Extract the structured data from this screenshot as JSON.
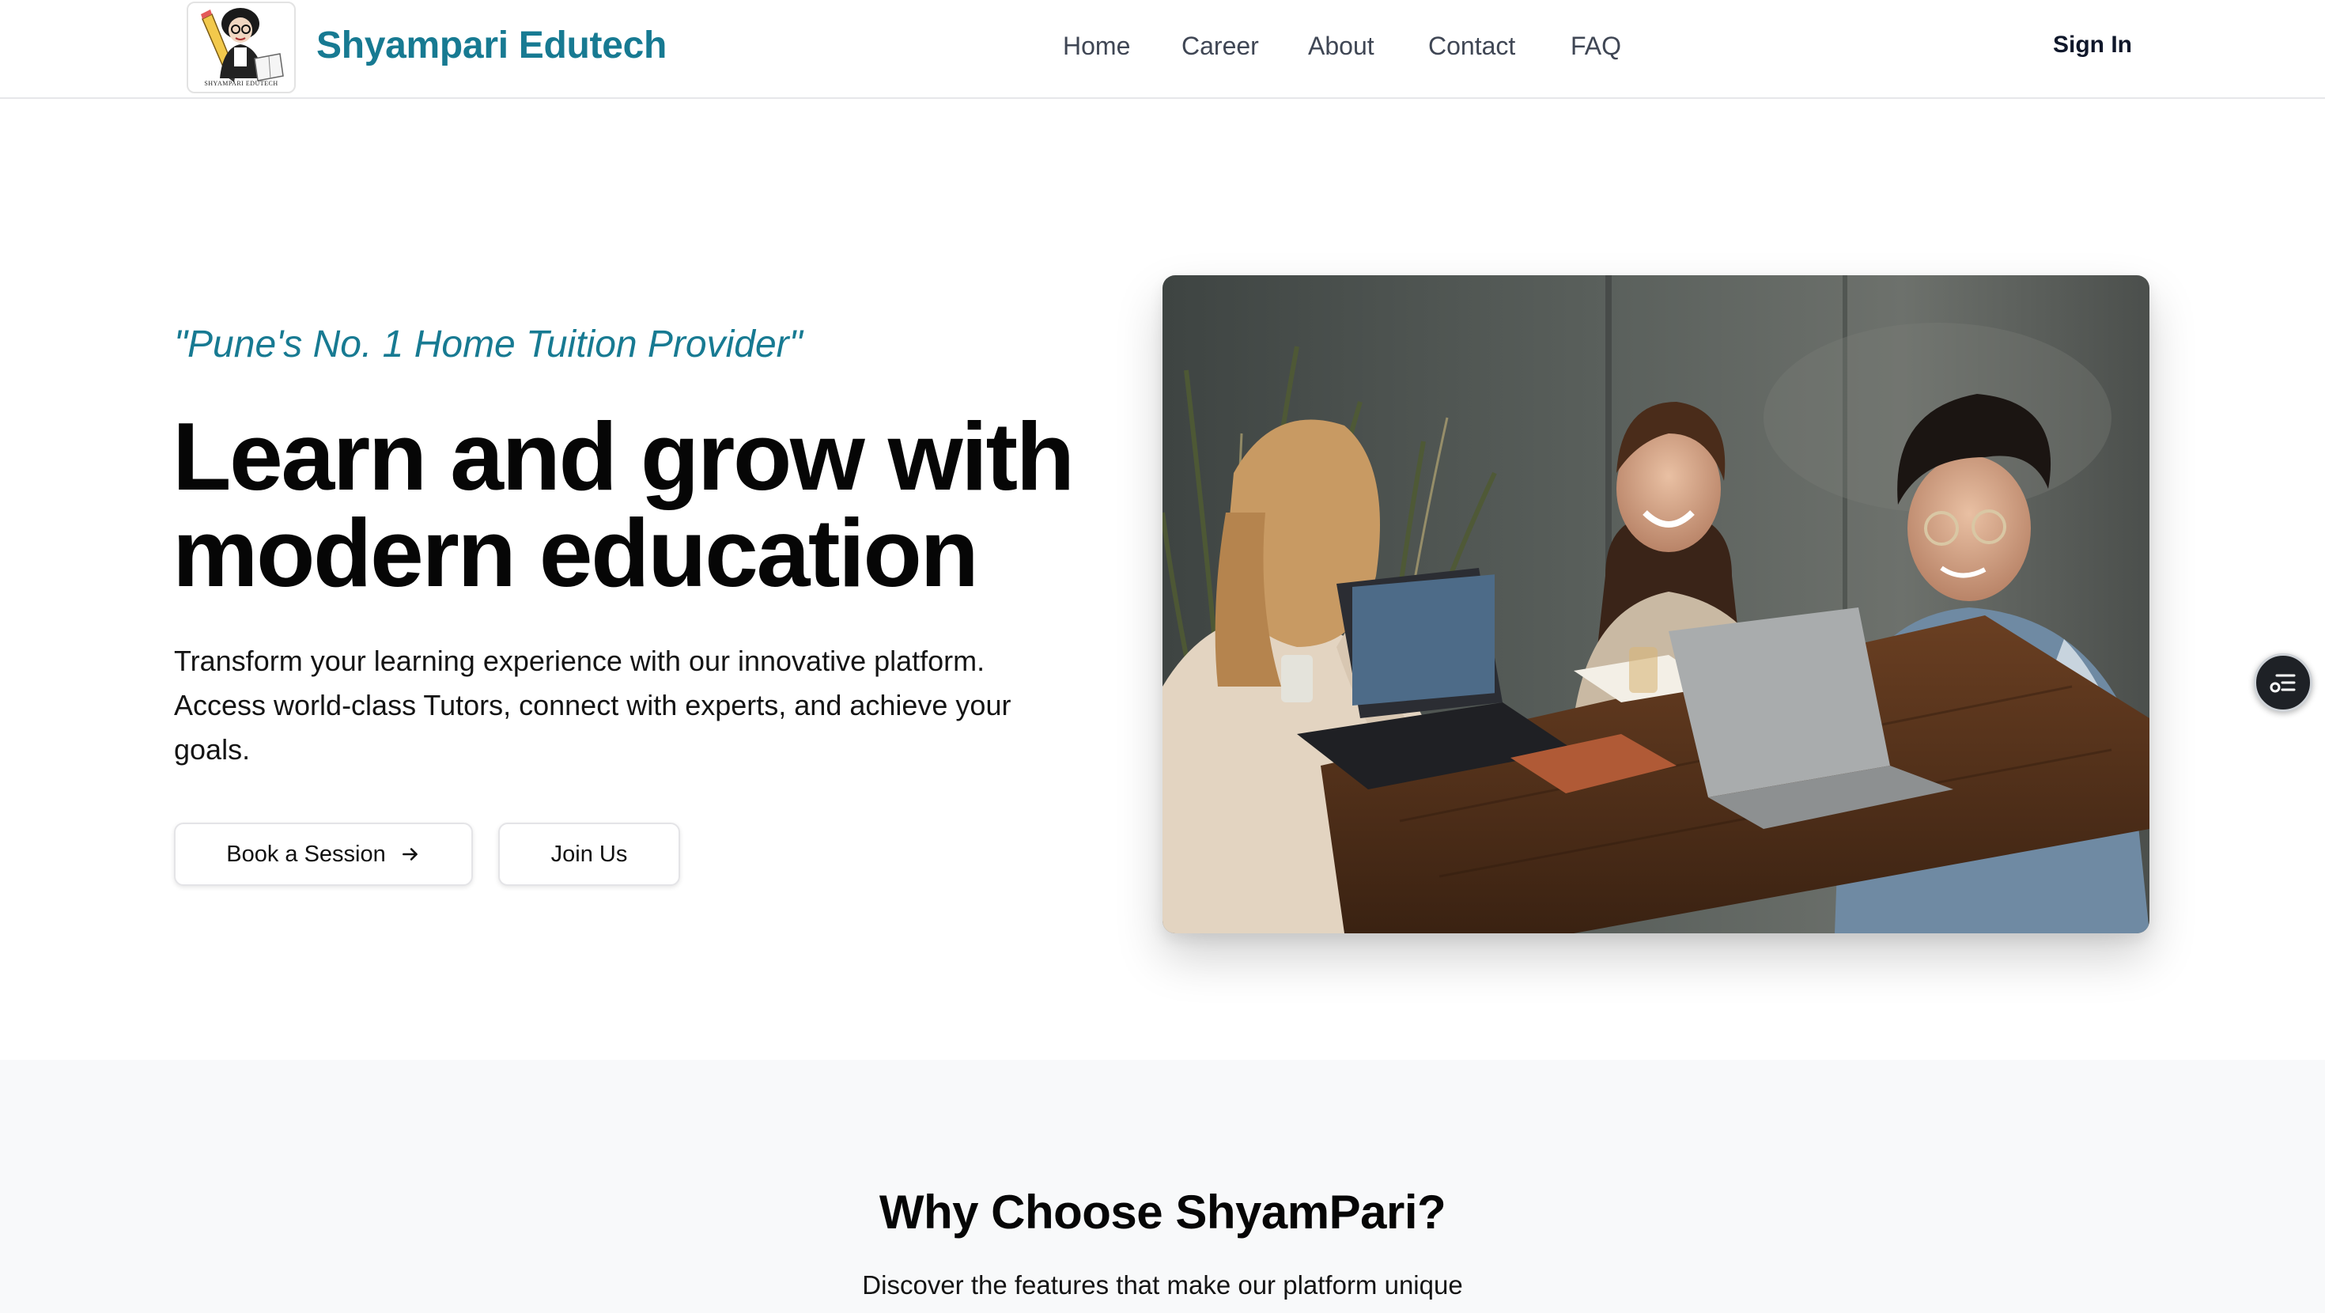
{
  "header": {
    "logo_text": "SHYAMPARI EDUTECH",
    "brand": "Shyampari Edutech",
    "nav": [
      {
        "label": "Home"
      },
      {
        "label": "Career"
      },
      {
        "label": "About"
      },
      {
        "label": "Contact"
      },
      {
        "label": "FAQ"
      }
    ],
    "sign_in": "Sign In"
  },
  "hero": {
    "tagline": "\"Pune's No. 1 Home Tuition Provider\"",
    "headline_line1": "Learn and grow with",
    "headline_line2": "modern education",
    "subtext": "Transform your learning experience with our innovative platform. Access world-class Tutors, connect with experts, and achieve your goals.",
    "book_label": "Book a Session",
    "join_label": "Join Us"
  },
  "features": {
    "title": "Why Choose ShyamPari?",
    "subtitle": "Discover the features that make our platform unique"
  },
  "colors": {
    "brand": "#177a92",
    "nav_text": "#3f4654",
    "features_bg": "#f8f9fa",
    "fab_bg": "#1e2126"
  },
  "icons": {
    "book_arrow": "arrow-right-icon",
    "fab": "list-filter-icon"
  }
}
